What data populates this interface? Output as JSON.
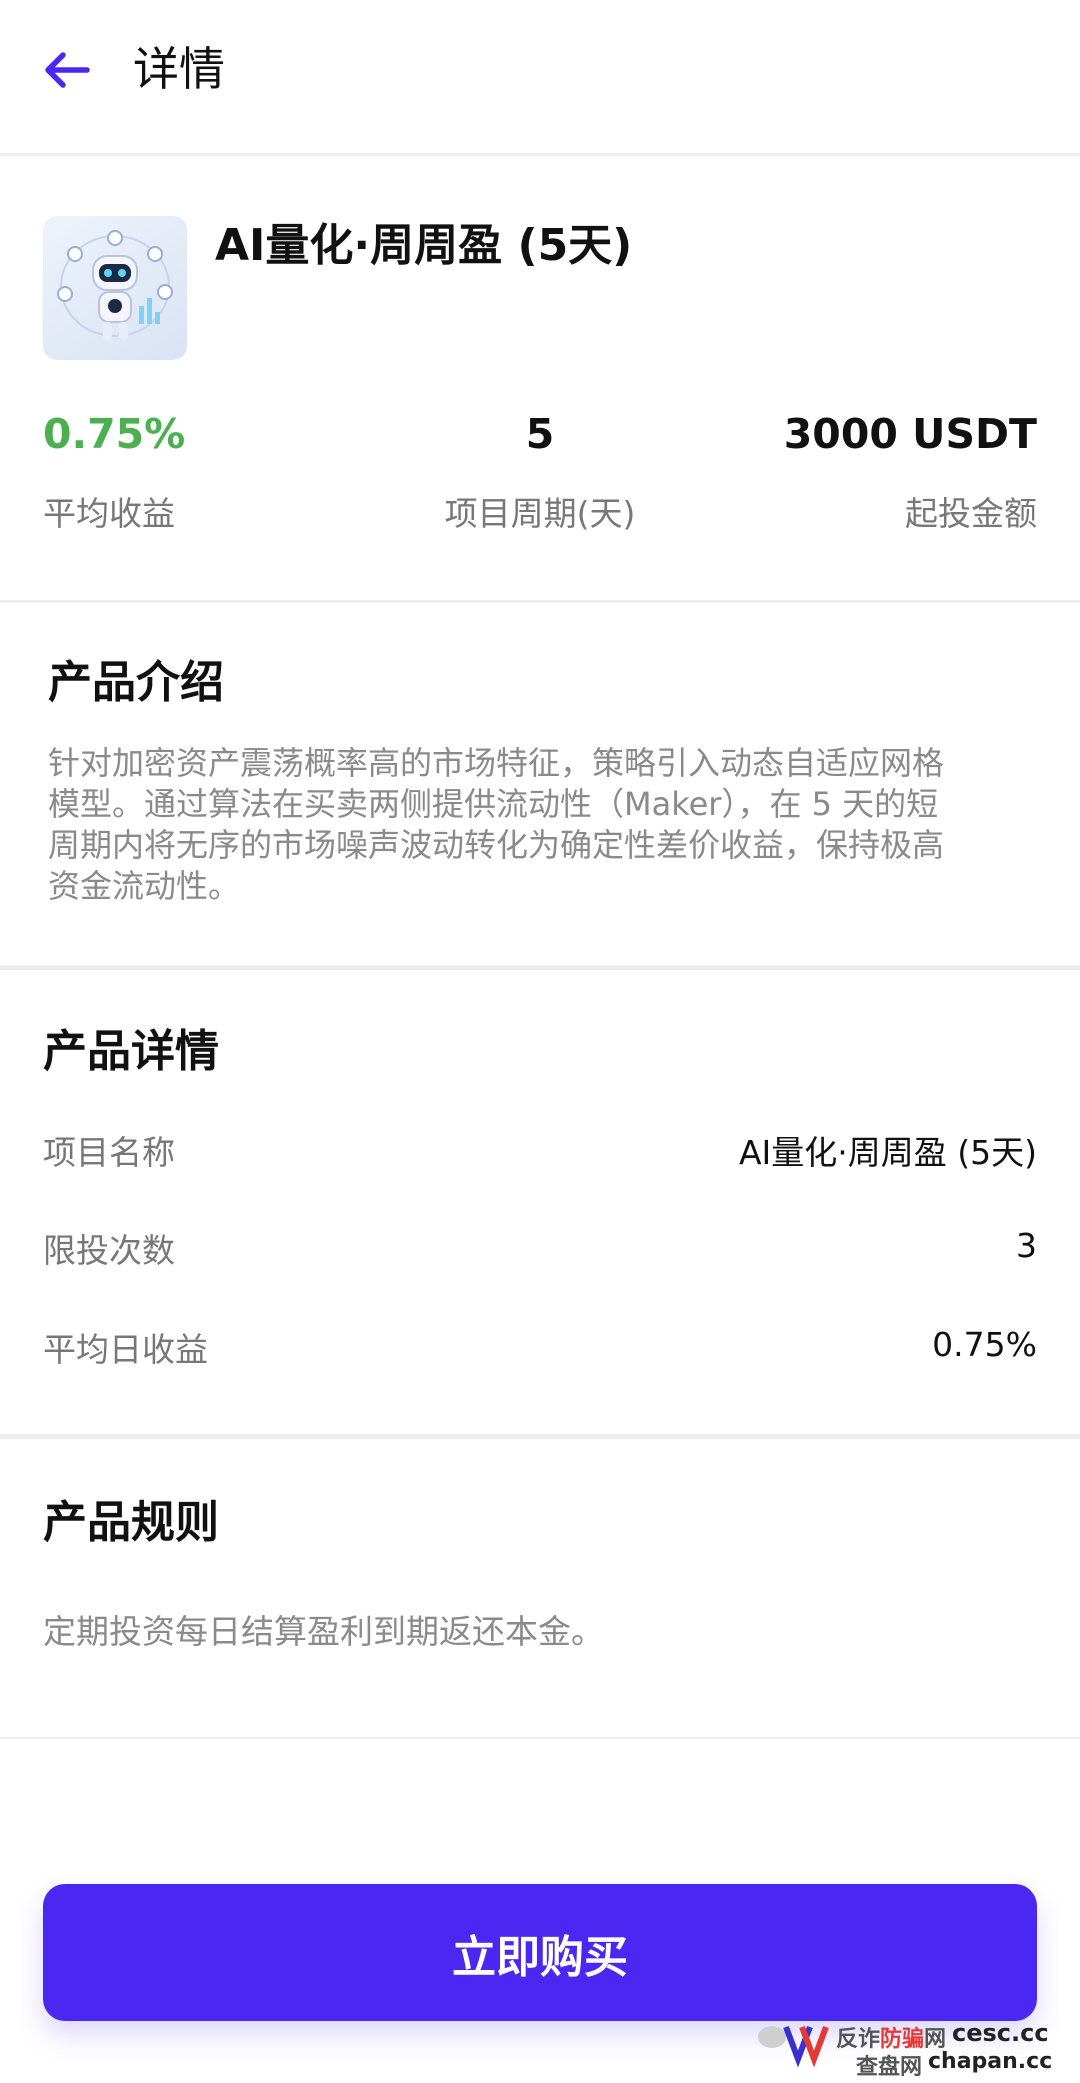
{
  "header": {
    "title": "详情"
  },
  "product": {
    "name": "AI量化·周周盈 (5天)",
    "stats": [
      {
        "value": "0.75%",
        "label": "平均收益"
      },
      {
        "value": "5",
        "label": "项目周期(天)"
      },
      {
        "value": "3000 USDT",
        "label": "起投金额"
      }
    ]
  },
  "intro": {
    "title": "产品介绍",
    "lines": [
      "针对加密资产震荡概率高的市场特征，策略引入动态自适应网格",
      "模型。通过算法在买卖两侧提供流动性（Maker），在 5 天的短",
      "周期内将无序的市场噪声波动转化为确定性差价收益，保持极高",
      "资金流动性。"
    ]
  },
  "details": {
    "title": "产品详情",
    "rows": [
      {
        "label": "项目名称",
        "value": "AI量化·周周盈 (5天)"
      },
      {
        "label": "限投次数",
        "value": "3"
      },
      {
        "label": "平均日收益",
        "value": "0.75%"
      }
    ]
  },
  "rules": {
    "title": "产品规则",
    "text": "定期投资每日结算盈利到期返还本金。"
  },
  "buy_button": {
    "label": "立即购买"
  },
  "watermark": {
    "line1_a": "反诈",
    "line1_b": "防骗",
    "line1_c": "网",
    "line2": "查盘网",
    "domain1": "cesc.cc",
    "domain2": "chapan.cc"
  },
  "colors": {
    "accent": "#4a28f2",
    "positive": "#4caf50"
  }
}
